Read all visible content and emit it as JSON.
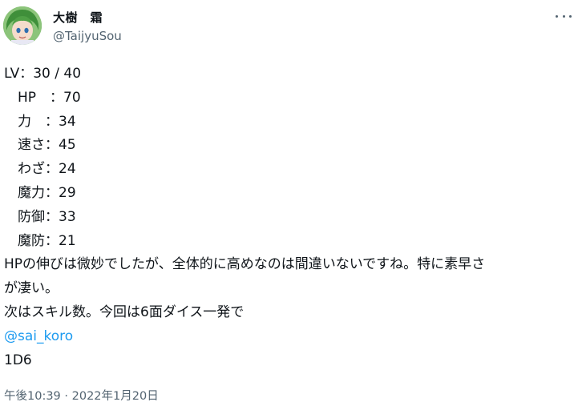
{
  "author": {
    "display_name": "大樹　霜",
    "handle": "@TaijyuSou",
    "avatar_icon": "avatar-image"
  },
  "menu": {
    "icon": "more-options-icon"
  },
  "tweet": {
    "lines": [
      "LV：30 / 40",
      "　HP　：70",
      "　力　：34",
      "　速さ：45",
      "　わざ：24",
      "　魔力：29",
      "　防御：33",
      "　魔防：21",
      "HPの伸びは微妙でしたが、全体的に高めなのは間違いないですね。特に素早さ",
      "が凄い。",
      "次はスキル数。今回は6面ダイス一発で"
    ],
    "mention": "@sai_koro",
    "last_line": "1D6"
  },
  "timestamp": "午後10:39 · 2022年1月20日",
  "colors": {
    "text": "#0f1419",
    "secondary": "#536471",
    "link": "#1d9bf0"
  }
}
